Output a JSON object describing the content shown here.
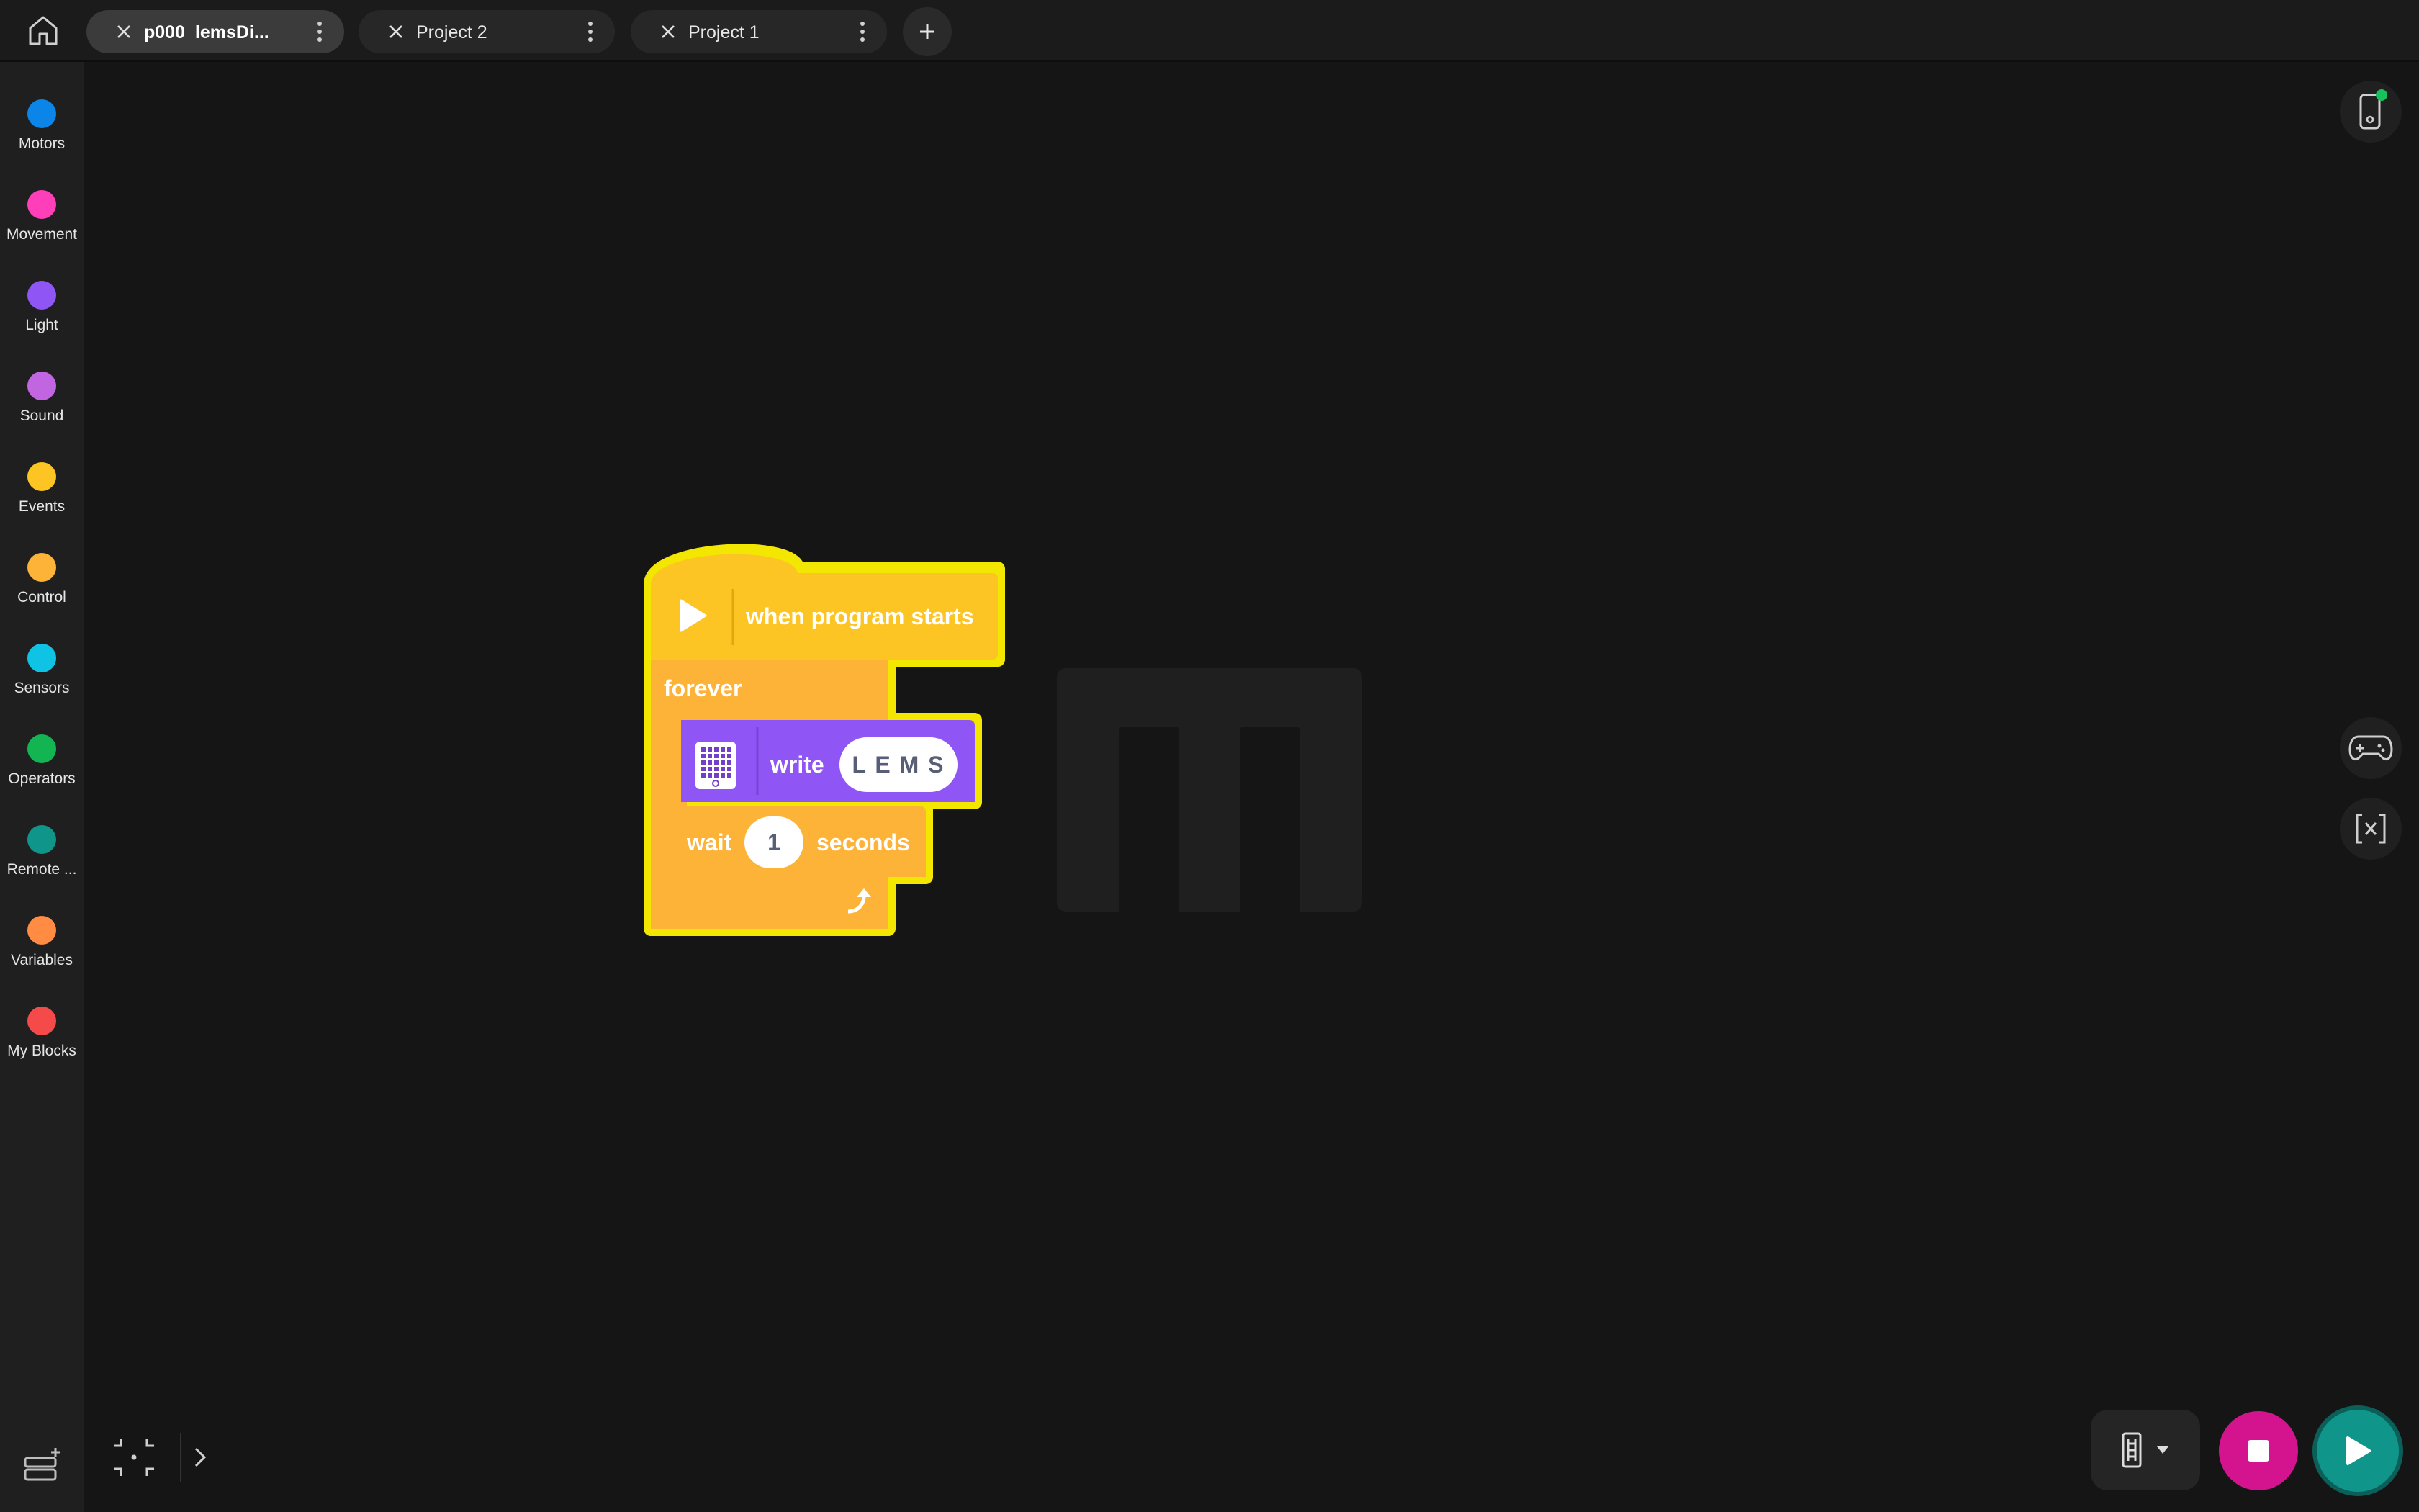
{
  "tabs": [
    {
      "label": "p000_lemsDi...",
      "active": true
    },
    {
      "label": "Project 2",
      "active": false
    },
    {
      "label": "Project 1",
      "active": false
    }
  ],
  "categories": [
    {
      "name": "Motors",
      "color": "#0b86e8"
    },
    {
      "name": "Movement",
      "color": "#ff3fb9"
    },
    {
      "name": "Light",
      "color": "#9055f5"
    },
    {
      "name": "Sound",
      "color": "#c166e0"
    },
    {
      "name": "Events",
      "color": "#fcc524"
    },
    {
      "name": "Control",
      "color": "#fdb338"
    },
    {
      "name": "Sensors",
      "color": "#0fc3e5"
    },
    {
      "name": "Operators",
      "color": "#13b552"
    },
    {
      "name": "Remote ...",
      "color": "#0f958a"
    },
    {
      "name": "Variables",
      "color": "#ff8c42"
    },
    {
      "name": "My Blocks",
      "color": "#f44a4a"
    }
  ],
  "blocks": {
    "hat_label": "when program starts",
    "forever_label": "forever",
    "write_label": "write",
    "write_value": "L E M S",
    "wait_label": "wait",
    "wait_value": "1",
    "wait_unit": "seconds"
  },
  "colors": {
    "events": "#fcc524",
    "control": "#fdb338",
    "light": "#9055f5",
    "highlight": "#fff200",
    "stop": "#d4148f",
    "run": "#0f958a"
  },
  "icons": {
    "home": "home-icon",
    "close": "close-icon",
    "more": "more-vertical-icon",
    "add": "plus-icon",
    "hub": "hub-device-icon",
    "gamepad": "gamepad-icon",
    "variable": "variable-icon",
    "display": "light-matrix-icon",
    "stop": "stop-icon",
    "run": "play-icon"
  }
}
